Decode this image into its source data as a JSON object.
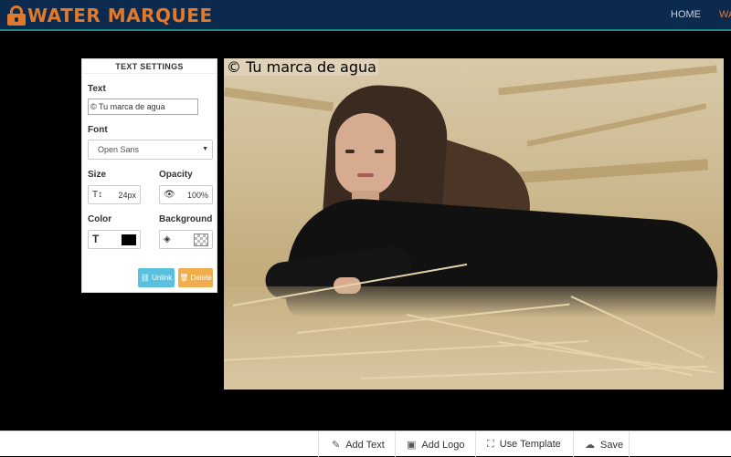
{
  "header": {
    "logo_text": "WATER MARQUEE",
    "nav": {
      "home": "HOME",
      "second": "WA"
    }
  },
  "text_settings": {
    "title": "TEXT SETTINGS",
    "text_label": "Text",
    "text_value": "© Tu marca de agua",
    "font_label": "Font",
    "font_value": "Open Sans",
    "size_label": "Size",
    "size_value": "24px",
    "opacity_label": "Opacity",
    "opacity_value": "100%",
    "color_label": "Color",
    "color_value": "#000000",
    "background_label": "Background",
    "unlink_label": "Unlink",
    "delete_label": "Delete"
  },
  "canvas": {
    "watermark_text": "© Tu marca de agua"
  },
  "toolbar": {
    "add_text": "Add Text",
    "add_logo": "Add Logo",
    "use_template": "Use Template",
    "save": "Save"
  },
  "colors": {
    "header_bg": "#0c2a4d",
    "brand_orange": "#e07a2a",
    "unlink_btn": "#5bc0de",
    "delete_btn": "#f0ad4e"
  }
}
